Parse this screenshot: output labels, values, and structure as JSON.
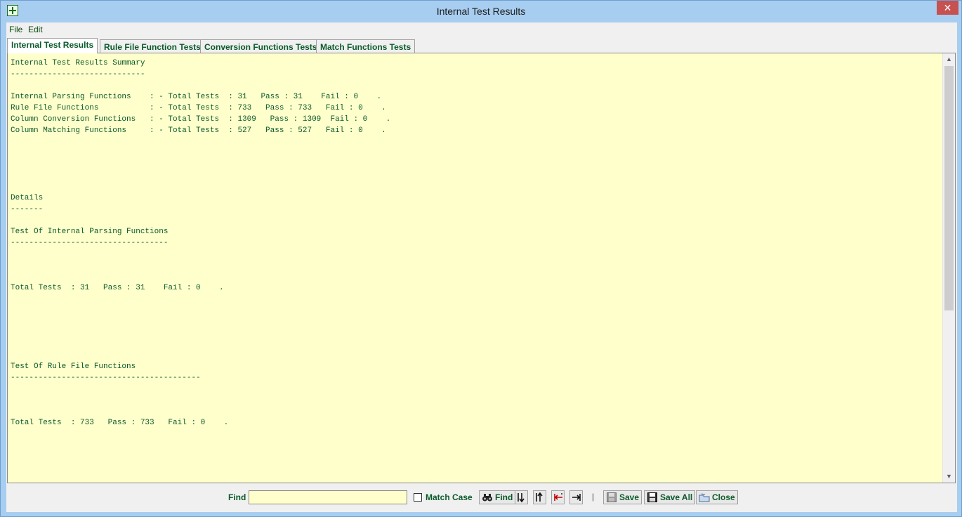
{
  "window": {
    "title": "Internal Test Results",
    "close_glyph": "✕"
  },
  "menu": [
    "File",
    "Edit"
  ],
  "tabs": [
    {
      "label": "Internal Test Results",
      "active": true
    },
    {
      "label": "Rule File Function Tests",
      "active": false
    },
    {
      "label": "Conversion Functions Tests",
      "active": false
    },
    {
      "label": "Match Functions Tests",
      "active": false
    }
  ],
  "report_lines": [
    "Internal Test Results Summary",
    "-----------------------------",
    "",
    "Internal Parsing Functions    : - Total Tests  : 31   Pass : 31    Fail : 0    .",
    "Rule File Functions           : - Total Tests  : 733   Pass : 733   Fail : 0    .",
    "Column Conversion Functions   : - Total Tests  : 1309   Pass : 1309  Fail : 0    .",
    "Column Matching Functions     : - Total Tests  : 527   Pass : 527   Fail : 0    .",
    "",
    "",
    "",
    "",
    "",
    "Details",
    "-------",
    "",
    "Test Of Internal Parsing Functions",
    "----------------------------------",
    "",
    "",
    "",
    "Total Tests  : 31   Pass : 31    Fail : 0    .",
    "",
    "",
    "",
    "",
    "",
    "",
    "Test Of Rule File Functions",
    "-----------------------------------------",
    "",
    "",
    "",
    "Total Tests  : 733   Pass : 733   Fail : 0    ."
  ],
  "bottom": {
    "find_label": "Find",
    "find_value": "",
    "find_placeholder": "",
    "match_case_label": "Match Case",
    "match_case_checked": false,
    "find_button": "Find",
    "separator": "|",
    "save_button": "Save",
    "save_all_button": "Save All",
    "close_button": "Close"
  },
  "colors": {
    "text_green": "#0b5a2b",
    "content_bg": "#ffffcc",
    "title_bar": "#a7cdf0",
    "close_red": "#c75050"
  },
  "icons": {
    "app": "add-icon",
    "find": "binoculars-icon",
    "next": "arrow-down-icon",
    "prev": "arrow-up-icon",
    "first": "arrow-left-bar-icon",
    "last": "arrow-right-bar-icon",
    "save": "floppy-disabled-icon",
    "save_all": "floppy-icon",
    "close": "folder-close-icon"
  }
}
